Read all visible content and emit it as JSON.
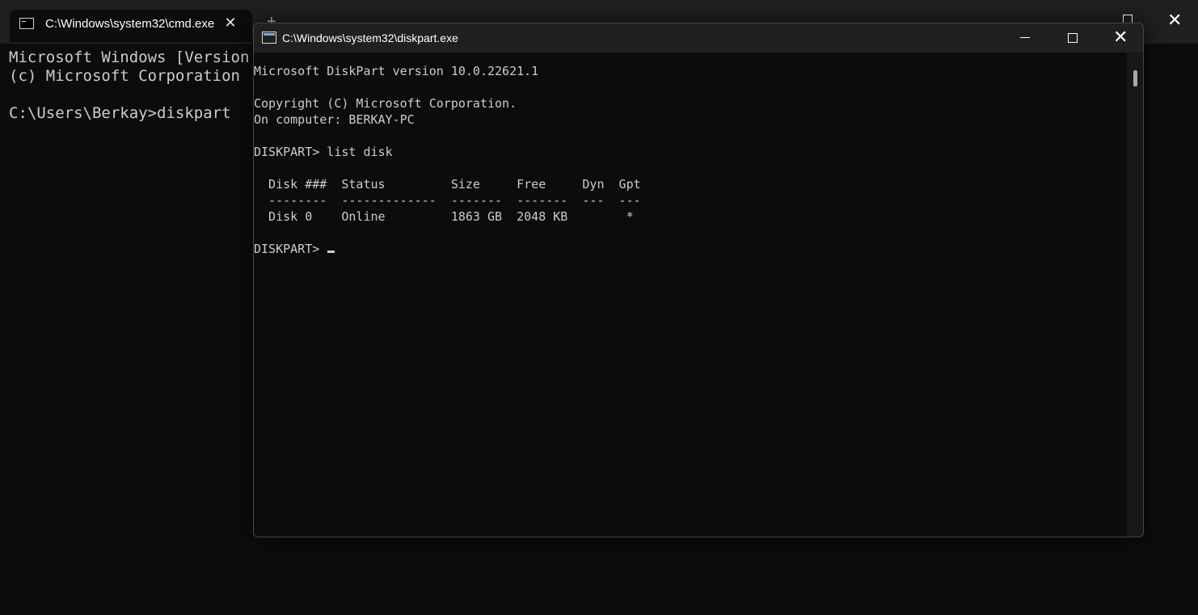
{
  "terminal": {
    "tab_title": "C:\\Windows\\system32\\cmd.exe",
    "new_tab_label": "+",
    "lines": [
      "Microsoft Windows [Version",
      "(c) Microsoft Corporation",
      "",
      "C:\\Users\\Berkay>diskpart"
    ]
  },
  "diskpart_window": {
    "title": "C:\\Windows\\system32\\diskpart.exe",
    "lines": [
      "Microsoft DiskPart version 10.0.22621.1",
      "",
      "Copyright (C) Microsoft Corporation.",
      "On computer: BERKAY-PC",
      "",
      "DISKPART> list disk",
      "",
      "  Disk ###  Status         Size     Free     Dyn  Gpt",
      "  --------  -------------  -------  -------  ---  ---",
      "  Disk 0    Online         1863 GB  2048 KB        *",
      "",
      "DISKPART> "
    ]
  },
  "icons": {
    "close": "close-icon",
    "minimize": "minimize-icon",
    "maximize": "maximize-icon",
    "console": "console-icon"
  }
}
